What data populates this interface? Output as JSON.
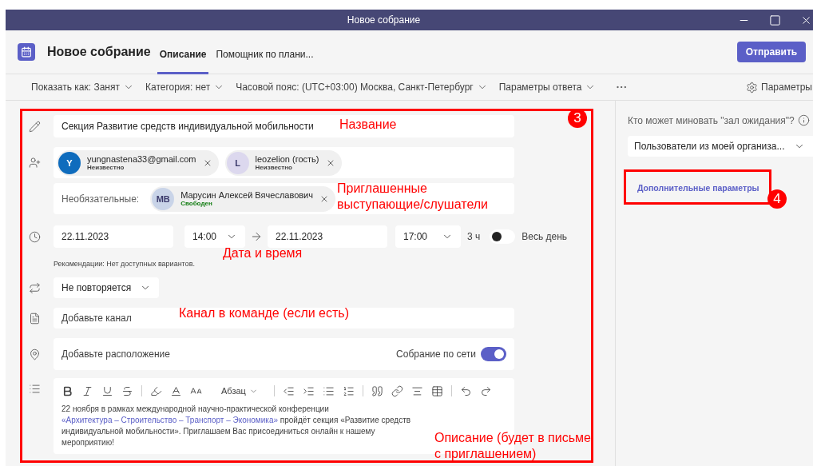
{
  "window": {
    "title": "Новое собрание"
  },
  "header": {
    "title": "Новое собрание",
    "tabs": [
      {
        "label": "Описание",
        "selected": true
      },
      {
        "label": "Помощник по плани...",
        "selected": false
      }
    ],
    "send_button": "Отправить"
  },
  "toolbar": {
    "items": [
      {
        "label": "Показать как: Занят"
      },
      {
        "label": "Категория: нет"
      },
      {
        "label": "Часовой пояс: (UTC+03:00) Москва, Санкт-Петербург"
      },
      {
        "label": "Параметры ответа"
      }
    ],
    "settings": "Параметры"
  },
  "form": {
    "title_value": "Секция Развитие средств индивидуальной мобильности",
    "attendees": [
      {
        "initials": "Y",
        "name": "yungnastena33@gmail.com",
        "status": "Неизвестно",
        "available": false,
        "color": "#0f6cbd"
      },
      {
        "initials": "L",
        "name": "leozelion (гость)",
        "status": "Неизвестно",
        "available": false,
        "color": "#dcd8ee"
      }
    ],
    "optional_label": "Необязательные:",
    "optional": [
      {
        "initials": "MB",
        "name": "Марусин Алексей Вячеславович",
        "status": "Свободен",
        "available": true,
        "color": "#c9d4e8"
      }
    ],
    "start_date": "22.11.2023",
    "start_time": "14:00",
    "end_date": "22.11.2023",
    "end_time": "17:00",
    "duration": "3 ч",
    "all_day": {
      "label": "Весь день",
      "on": false
    },
    "recommendation": "Рекомендации: Нет доступных вариантов.",
    "repeat": "Не повторяется",
    "channel_placeholder": "Добавьте канал",
    "location_placeholder": "Добавьте расположение",
    "online": {
      "label": "Собрание по сети",
      "on": true
    },
    "paragraph_style": "Абзац",
    "description": [
      {
        "kind": "text",
        "text": "22 ноября в рамках международной научно-практической конференции "
      },
      {
        "kind": "link",
        "text": "«Архитектура – Строительство – Транспорт – Экономика»"
      },
      {
        "kind": "text",
        "text": " пройдёт секция «Развитие средств индивидуальной мобильности». Приглашаем Вас присоединиться онлайн к нашему мероприятию!"
      }
    ]
  },
  "side_panel": {
    "lobby_label": "Кто может миновать \"зал ожидания\"?",
    "lobby_value": "Пользователи из моей организа...",
    "more_options": "Дополнительные параметры"
  },
  "annotations": [
    {
      "text": "Название"
    },
    {
      "text": "Приглашенные выступающие/слушатели"
    },
    {
      "text": "Дата и время"
    },
    {
      "text": "Канал в команде (если есть)"
    },
    {
      "text": "Описание (будет в письме с приглашением)"
    }
  ],
  "badges": [
    "3",
    "4"
  ]
}
